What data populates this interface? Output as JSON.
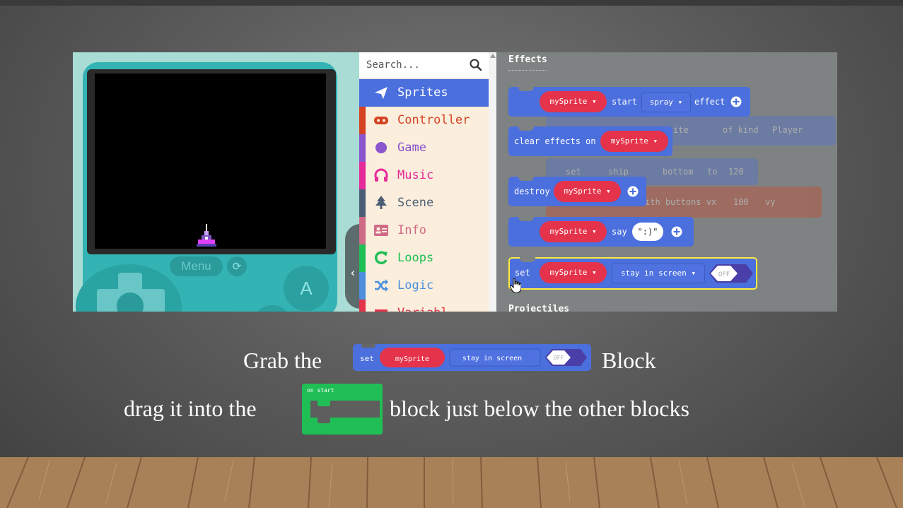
{
  "simulator": {
    "menu_label": "Menu",
    "a_label": "A"
  },
  "toolbox": {
    "search_placeholder": "Search...",
    "categories": [
      {
        "label": "Sprites",
        "color": "#4b6fdd",
        "icon": "paper-plane-icon",
        "selected": true
      },
      {
        "label": "Controller",
        "color": "#d54322",
        "icon": "gamepad-icon"
      },
      {
        "label": "Game",
        "color": "#8b55ce",
        "icon": "circle-icon"
      },
      {
        "label": "Music",
        "color": "#e52a9a",
        "icon": "headphones-icon"
      },
      {
        "label": "Scene",
        "color": "#4b5e76",
        "icon": "tree-icon"
      },
      {
        "label": "Info",
        "color": "#cf6a87",
        "icon": "id-card-icon"
      },
      {
        "label": "Loops",
        "color": "#20bf55",
        "icon": "refresh-icon"
      },
      {
        "label": "Logic",
        "color": "#4b8fdd",
        "icon": "shuffle-icon"
      },
      {
        "label": "Variabl",
        "color": "#e4334a",
        "icon": "list-icon"
      }
    ]
  },
  "workspace": {
    "section_title": "Effects",
    "next_section_title": "Projectiles",
    "blocks": {
      "start_effect": {
        "sprite": "mySprite",
        "verb": "start",
        "effect": "spray",
        "suffix": "effect"
      },
      "clear_effects": {
        "prefix": "clear effects on",
        "sprite": "mySprite"
      },
      "destroy": {
        "prefix": "destroy",
        "sprite": "mySprite"
      },
      "say": {
        "sprite": "mySprite",
        "verb": "say",
        "text": "\":)\""
      },
      "stay_in_screen": {
        "prefix": "set",
        "sprite": "mySprite",
        "option": "stay in screen",
        "toggle": "OFF"
      }
    },
    "ghost": {
      "sprite_label": "ite",
      "kind_label": "of kind",
      "kind_value": "Player",
      "set_label": "set",
      "ship_label": "ship",
      "bottom_label": "bottom",
      "to_label": "to",
      "to_value": "120",
      "buttons_label": "ith buttons vx",
      "vx_value": "100",
      "vy_label": "vy"
    }
  },
  "caption": {
    "line1_prefix": "Grab the",
    "line1_suffix": "Block",
    "line2_prefix": "drag it into the",
    "line2_suffix": "block just below the other blocks",
    "inline_set": {
      "prefix": "set",
      "sprite": "mySprite",
      "option": "stay in screen",
      "toggle": "OFF"
    },
    "inline_on_start": "on start"
  }
}
